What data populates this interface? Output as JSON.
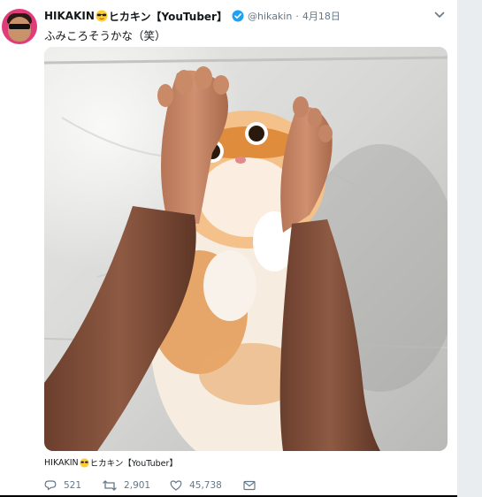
{
  "tweet": {
    "display_name": "HIKAKIN",
    "name_suffix": "ヒカキン【YouTuber】",
    "handle": "@hikakin",
    "separator": "·",
    "date": "4月18日",
    "text": "ふみころそうかな（笑）",
    "source_name": "HIKAKIN",
    "source_suffix": "ヒカキン【YouTuber】",
    "replies": "521",
    "retweets": "2,901",
    "likes": "45,738"
  },
  "icons": {
    "verified": "verified-badge-icon",
    "caret": "chevron-down-icon",
    "reply": "reply-icon",
    "retweet": "retweet-icon",
    "like": "heart-icon",
    "dm": "envelope-icon",
    "emoji": "sunglasses-emoji-icon"
  },
  "colors": {
    "verified_blue": "#1da1f2",
    "secondary_text": "#657786",
    "primary_text": "#14171a",
    "background": "#ffffff"
  }
}
